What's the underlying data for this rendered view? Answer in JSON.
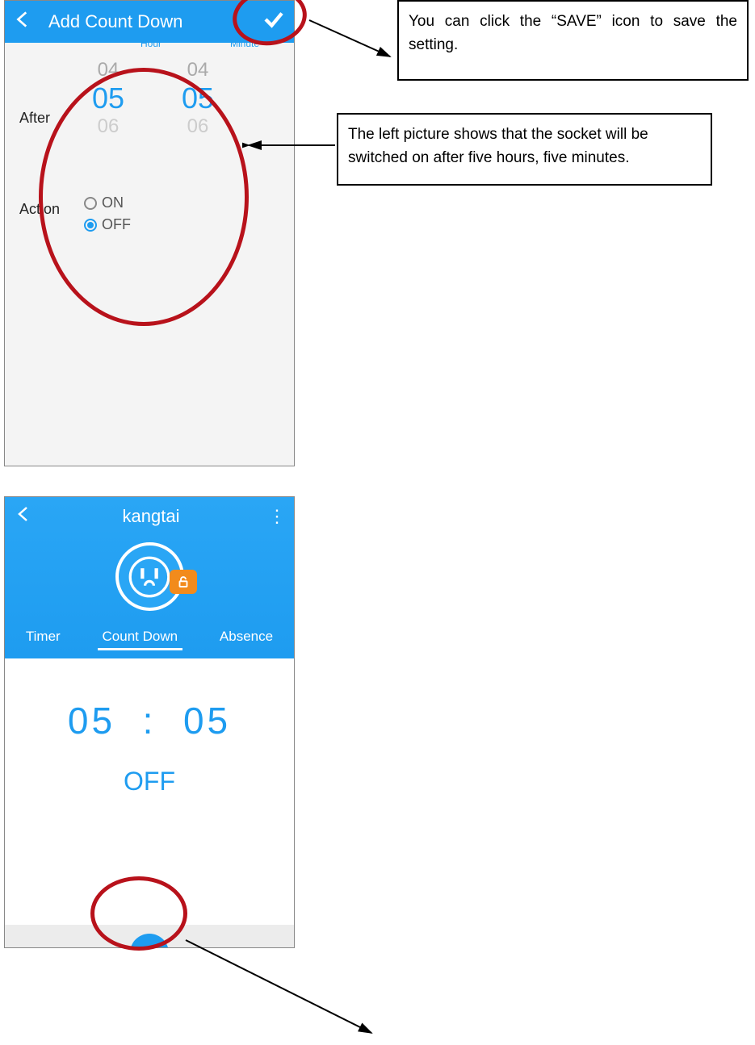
{
  "phone1": {
    "title": "Add Count Down",
    "afterLabel": "After",
    "hourUnit": "Hour",
    "minuteUnit": "Minute",
    "hours": {
      "above": "04",
      "selected": "05",
      "below": "06"
    },
    "minutes": {
      "above": "04",
      "selected": "05",
      "below": "06"
    },
    "actionLabel": "Action",
    "options": {
      "on": "ON",
      "off": "OFF"
    },
    "selected": "off"
  },
  "phone2": {
    "title": "kangtai",
    "tabs": {
      "timer": "Timer",
      "countdown": "Count Down",
      "absence": "Absence"
    },
    "activeTab": "countdown",
    "timeHour": "05",
    "timeSep": ":",
    "timeMin": "05",
    "state": "OFF"
  },
  "callouts": {
    "c1": "You can click the “SAVE” icon to save the setting.",
    "c2": "The left picture shows that the socket will be switched on after five hours, five minutes."
  }
}
